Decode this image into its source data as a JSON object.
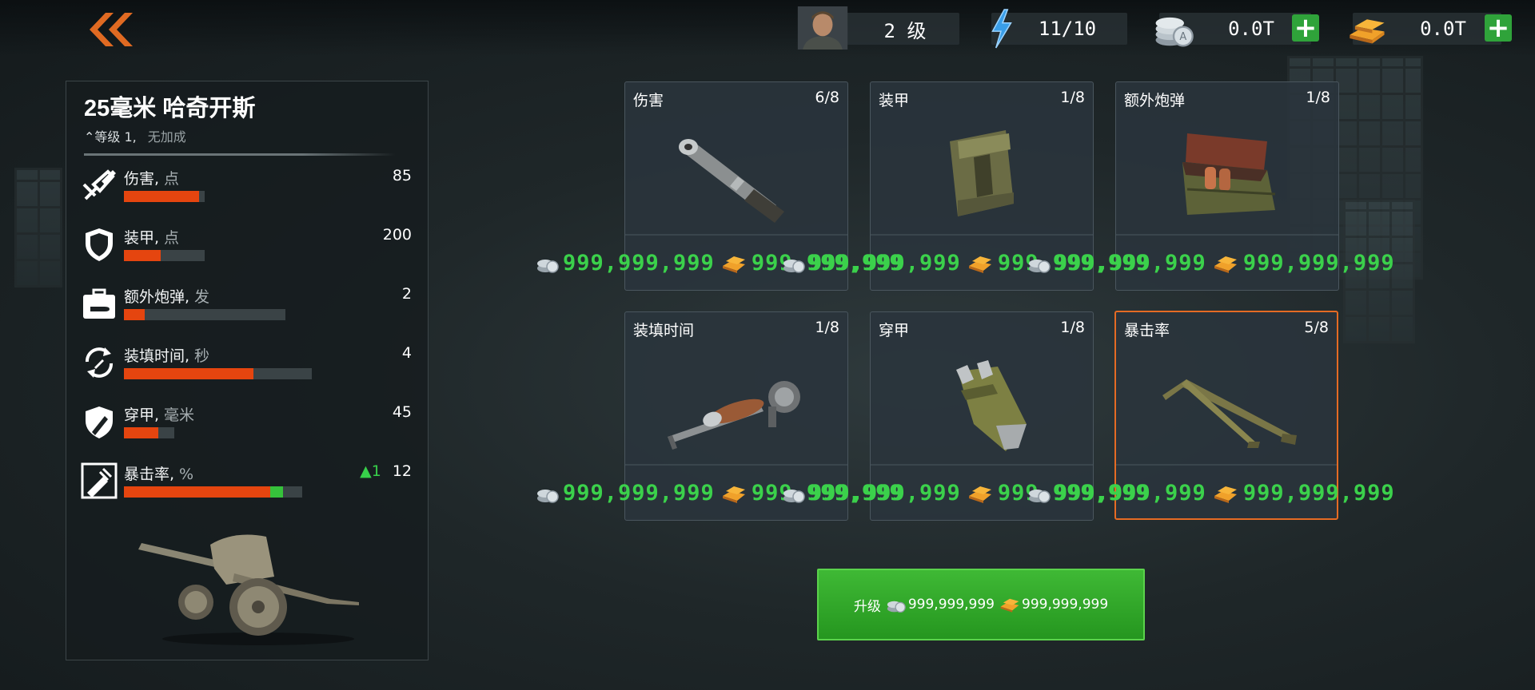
{
  "header": {
    "player_level": "2 级",
    "energy": "11/10",
    "silver": "0.0T",
    "gold": "0.0T"
  },
  "weapon": {
    "name": "25毫米 哈奇开斯",
    "level_label": "等级 1,",
    "bonus_label": "无加成"
  },
  "stats": [
    {
      "label": "伤害,",
      "unit": "点",
      "value": "85",
      "delta": "",
      "fill": 0.93,
      "bar_total": 0.24
    },
    {
      "label": "装甲,",
      "unit": "点",
      "value": "200",
      "delta": "",
      "fill": 0.46,
      "bar_total": 0.24
    },
    {
      "label": "额外炮弹,",
      "unit": "发",
      "value": "2",
      "delta": "",
      "fill": 0.13,
      "bar_total": 0.48
    },
    {
      "label": "装填时间,",
      "unit": "秒",
      "value": "4",
      "delta": "",
      "fill": 0.69,
      "bar_total": 0.56
    },
    {
      "label": "穿甲,",
      "unit": "毫米",
      "value": "45",
      "delta": "",
      "fill": 0.68,
      "bar_total": 0.15
    },
    {
      "label": "暴击率,",
      "unit": "%",
      "value": "12",
      "delta": "▲1",
      "fill": 0.82,
      "bonus": 0.07,
      "bar_total": 0.53
    }
  ],
  "cards": [
    {
      "name": "伤害",
      "level": "6/8",
      "silver": "999,999,999",
      "gold": "999,999,999",
      "icon": "barrel-icon",
      "selected": false
    },
    {
      "name": "装甲",
      "level": "1/8",
      "silver": "999,999,999",
      "gold": "999,999,999",
      "icon": "armor-plate-icon",
      "selected": false
    },
    {
      "name": "额外炮弹",
      "level": "1/8",
      "silver": "999,999,999",
      "gold": "999,999,999",
      "icon": "ammo-crate-icon",
      "selected": false
    },
    {
      "name": "装填时间",
      "level": "1/8",
      "silver": "999,999,999",
      "gold": "999,999,999",
      "icon": "breech-icon",
      "selected": false
    },
    {
      "name": "穿甲",
      "level": "1/8",
      "silver": "999,999,999",
      "gold": "999,999,999",
      "icon": "shell-tip-icon",
      "selected": false
    },
    {
      "name": "暴击率",
      "level": "5/8",
      "silver": "999,999,999",
      "gold": "999,999,999",
      "icon": "gun-carriage-icon",
      "selected": true
    }
  ],
  "upgrade": {
    "label": "升级",
    "silver": "999,999,999",
    "gold": "999,999,999"
  },
  "colors": {
    "accent_orange": "#e56b24",
    "bar_fill": "#e5450f",
    "price_green": "#3bd14b",
    "button_green": "#2fa33a"
  }
}
